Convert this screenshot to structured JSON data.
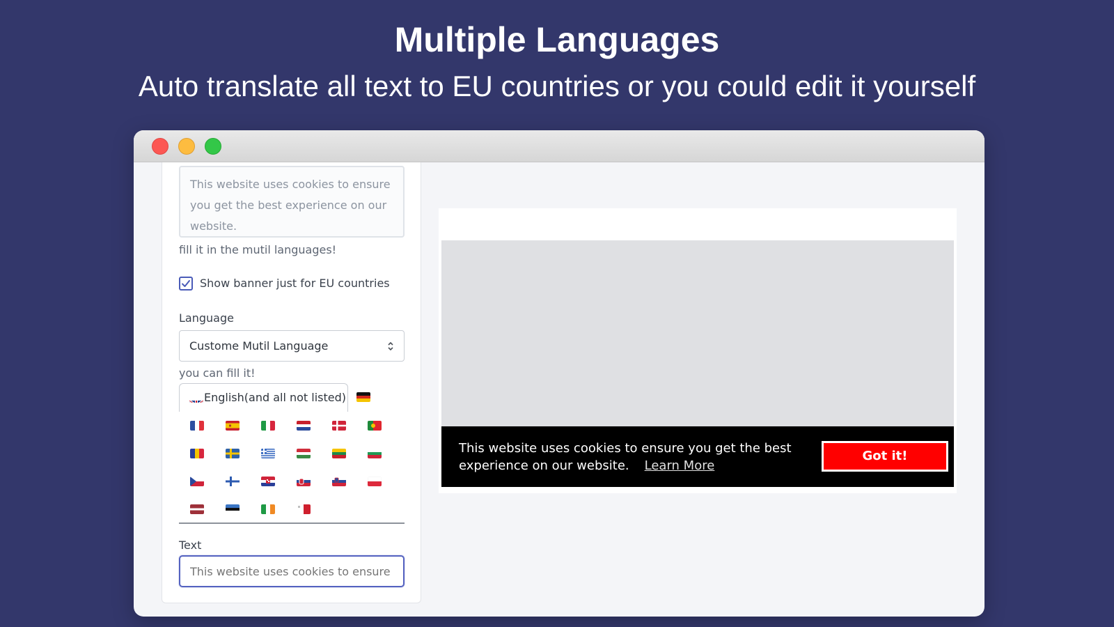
{
  "header": {
    "title": "Multiple Languages",
    "subtitle": "Auto translate all text to EU countries or you could edit it yourself"
  },
  "window": {
    "controls": [
      "close",
      "minimize",
      "zoom"
    ]
  },
  "settings": {
    "message_textarea": "This website uses cookies to ensure you get the best experience on our website.",
    "multilang_hint": "fill it in the mutil languages!",
    "eu_checkbox": {
      "label": "Show banner just for EU countries",
      "checked": true
    },
    "language_label": "Language",
    "language_select": "Custome Mutil Language",
    "fill_hint": "you can fill it!",
    "active_tab": {
      "flag": "gb",
      "label": "English(and all not listed)"
    },
    "flags": [
      "de",
      "fr",
      "es",
      "it",
      "nl",
      "dk",
      "pt",
      "ro",
      "se",
      "gr",
      "hu",
      "lt",
      "bg",
      "cz",
      "fi",
      "hr",
      "sk",
      "si",
      "pl",
      "lv",
      "ee",
      "ie",
      "mt"
    ],
    "text_label": "Text",
    "text_placeholder": "This website uses cookies to ensure you get the best experience on our website."
  },
  "preview": {
    "banner_message": "This website uses cookies to ensure you get the best experience on our website.",
    "learn_more": "Learn More",
    "accept_button": "Got it!",
    "colors": {
      "banner_bg": "#000000",
      "button_bg": "#ff0000",
      "button_text": "#ffffff"
    }
  },
  "colors": {
    "page_bg": "#33376b",
    "accent": "#5462c0"
  }
}
